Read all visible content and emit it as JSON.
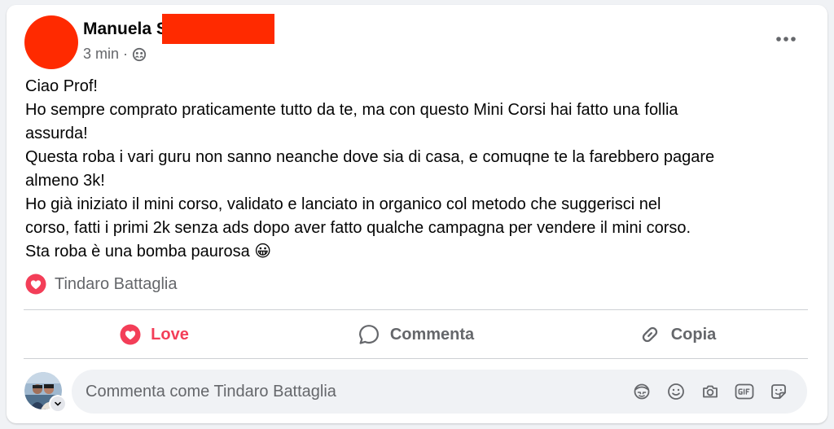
{
  "post": {
    "author_name": "Manuela S",
    "timestamp": "3 min",
    "separator": "·",
    "audience_icon": "friends-icon",
    "menu_icon": "more-horizontal-icon",
    "body_lines": [
      "Ciao Prof!",
      "Ho sempre comprato praticamente tutto da te, ma con questo Mini Corsi hai fatto una follia",
      "assurda!",
      "Questa roba i vari guru non sanno neanche dove sia di casa, e comuqne te la farebbero pagare",
      "almeno 3k!",
      "Ho già iniziato il mini corso, validato e lanciato in organico col metodo che suggerisci nel",
      "corso, fatti i primi 2k senza ads dopo aver fatto qualche campagna per vendere il mini corso.",
      "Sta roba è una bomba paurosa 😀"
    ]
  },
  "reactions": {
    "icon": "love-reaction-icon",
    "names": "Tindaro Battaglia"
  },
  "actions": {
    "love_label": "Love",
    "comment_label": "Commenta",
    "copy_label": "Copia"
  },
  "comment_composer": {
    "placeholder": "Commenta come Tindaro Battaglia",
    "tools": [
      "avatar-sticker-icon",
      "emoji-icon",
      "camera-icon",
      "gif-icon",
      "sticker-icon"
    ]
  },
  "colors": {
    "love": "#f33e58",
    "redaction": "#ff2a00",
    "secondary_text": "#65676b",
    "page_background": "#f0f2f5"
  }
}
